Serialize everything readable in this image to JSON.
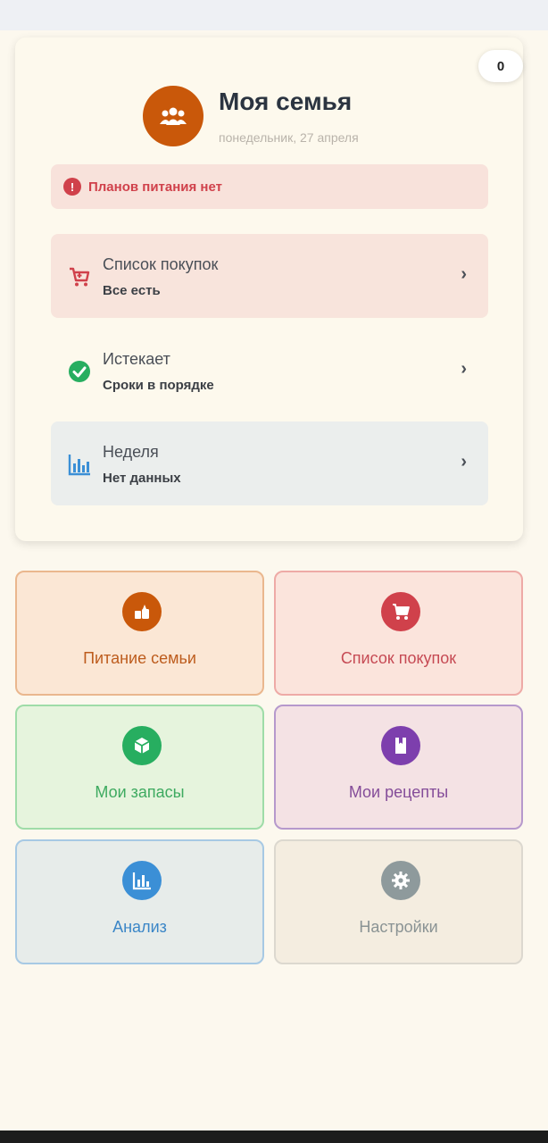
{
  "header": {
    "counter": "0",
    "title": "Моя семья",
    "date": "понедельник, 27 апреля",
    "alert": "Планов питания нет"
  },
  "summary": [
    {
      "title": "Список покупок",
      "subtitle": "Все есть",
      "icon": "cart-icon",
      "color": "#d0414b"
    },
    {
      "title": "Истекает",
      "subtitle": "Сроки в порядке",
      "icon": "check-circle-icon",
      "color": "#27ae60"
    },
    {
      "title": "Неделя",
      "subtitle": "Нет данных",
      "icon": "bar-chart-icon",
      "color": "#3b8fd6"
    }
  ],
  "tiles": {
    "nutrition": "Питание семьи",
    "shopping": "Список покупок",
    "stock": "Мои запасы",
    "recipes": "Мои рецепты",
    "analysis": "Анализ",
    "settings": "Настройки"
  },
  "colors": {
    "accent_orange": "#c9580a",
    "red": "#d0414b",
    "green": "#27ae60",
    "purple": "#7d3fad",
    "blue": "#3b8fd6",
    "gray": "#8e9a9c"
  }
}
